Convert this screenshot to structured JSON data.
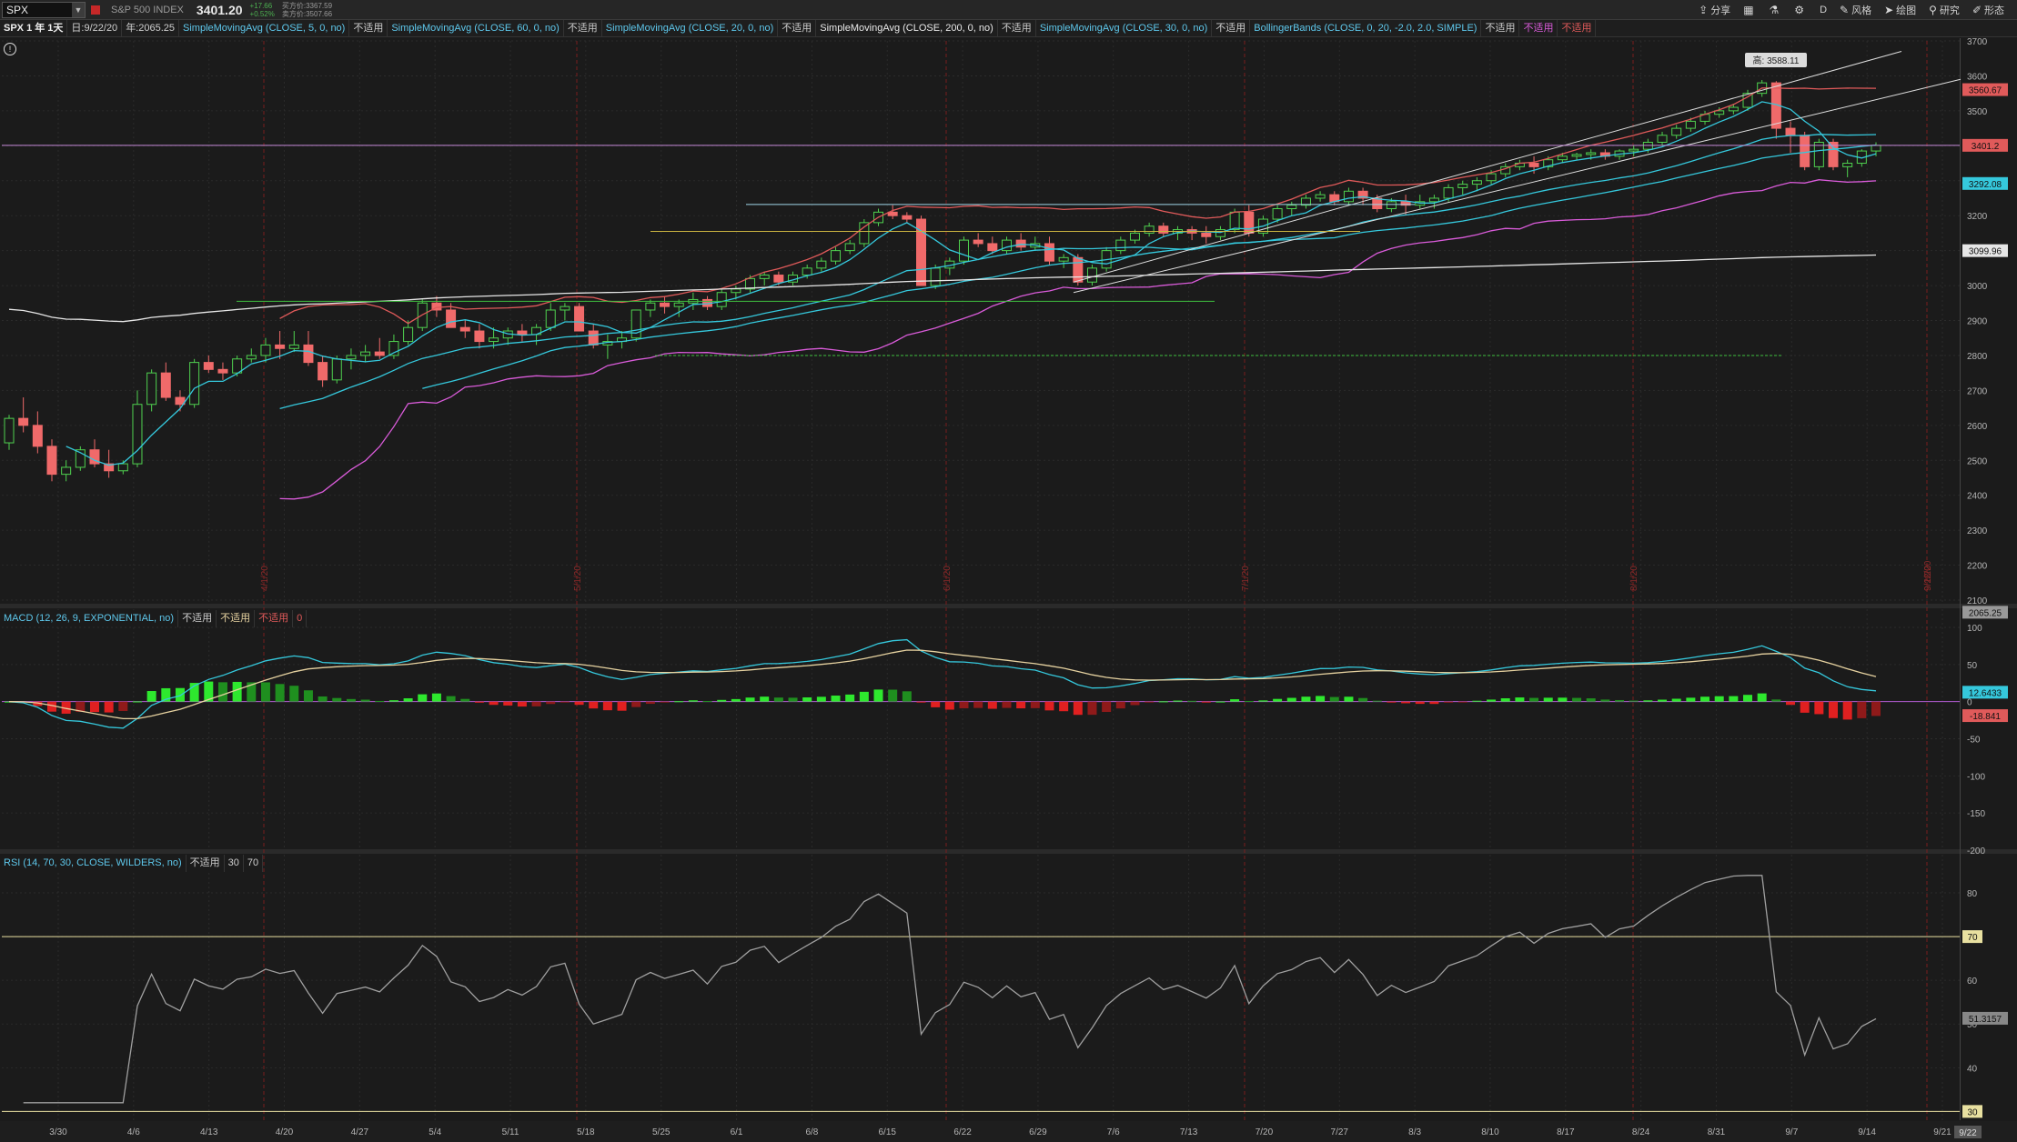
{
  "toolbar": {
    "symbol": "SPX",
    "index_name": "S&P 500 INDEX",
    "last_price": "3401.20",
    "change": "+17.66",
    "change_pct": "+0.52%",
    "bid_line": "买方价:3367.59",
    "ask_line": "卖方价:3507.66",
    "buttons": [
      {
        "label": "分享",
        "icon": "share-icon"
      },
      {
        "label": "",
        "icon": "calendar-icon"
      },
      {
        "label": "",
        "icon": "flask-icon"
      },
      {
        "label": "",
        "icon": "gear-icon"
      },
      {
        "label": "D",
        "icon": ""
      },
      {
        "label": "风格",
        "icon": "style-icon"
      },
      {
        "label": "绘图",
        "icon": "cursor-icon"
      },
      {
        "label": "研究",
        "icon": "study-icon"
      },
      {
        "label": "形态",
        "icon": "pattern-icon"
      }
    ]
  },
  "studybar": {
    "symbol_period": "SPX 1 年 1天",
    "date": "日:9/22/20",
    "year_value": "年:2065.25",
    "studies": [
      {
        "name": "SimpleMovingAvg (CLOSE, 5, 0, no)",
        "color": "#5ec8ec",
        "na": "不适用"
      },
      {
        "name": "SimpleMovingAvg (CLOSE, 60, 0, no)",
        "color": "#5ec8ec",
        "na": "不适用"
      },
      {
        "name": "SimpleMovingAvg (CLOSE, 20, 0, no)",
        "color": "#5ec8ec",
        "na": "不适用"
      },
      {
        "name": "SimpleMovingAvg (CLOSE, 200, 0, no)",
        "color": "#e8e8e8",
        "na": "不适用"
      },
      {
        "name": "SimpleMovingAvg (CLOSE, 30, 0, no)",
        "color": "#5ec8ec",
        "na": "不适用"
      },
      {
        "name": "BollingerBands (CLOSE, 0, 20, -2.0, 2.0, SIMPLE)",
        "color": "#5ec8ec",
        "na": "不适用"
      }
    ],
    "extra_na": [
      "不适用",
      "不适用"
    ]
  },
  "colors": {
    "up": "#4fd14f",
    "down": "#f06a6a",
    "grid": "#2b2b2b",
    "axis_text": "#b5b5b5",
    "ma_cyan": "#35c8dc",
    "ma_magenta": "#d95bd9",
    "ma_red": "#e05a5a",
    "ma_white": "#e6e6e6",
    "macd_line": "#35c8dc",
    "signal_line": "#e6d2a0",
    "rsi_line": "#a0a0a0",
    "rsi_ob": "#f06a50"
  },
  "price_pane": {
    "high_label": "高: 3588.11",
    "ticks": [
      "3700",
      "3600",
      "3500",
      "3400",
      "3300",
      "3200",
      "3100",
      "3000",
      "2900",
      "2800",
      "2700",
      "2600",
      "2500",
      "2400",
      "2300",
      "2200",
      "2100"
    ],
    "right_labels": [
      {
        "text": "3560.67",
        "value": 3560.67,
        "color": "#e05a5a"
      },
      {
        "text": "3401.2",
        "value": 3401.2,
        "color": "#e05a5a"
      },
      {
        "text": "3292.08",
        "value": 3292.08,
        "color": "#35c8dc"
      },
      {
        "text": "3099.96",
        "value": 3099.96,
        "color": "#e6e6e6"
      },
      {
        "text": "2065.25",
        "value": 2065.25,
        "color": "#999999"
      }
    ],
    "month_markers": [
      "4/1/20",
      "5/1/20",
      "6/1/20",
      "7/1/20",
      "8/1/20",
      "9/1/20",
      "9/22/20"
    ]
  },
  "macd_pane": {
    "label": "MACD (12, 26, 9, EXPONENTIAL, no)",
    "na": [
      "不适用",
      "不适用",
      "不适用"
    ],
    "zero": "0",
    "ticks": [
      "100",
      "50",
      "0",
      "-50",
      "-100",
      "-150",
      "-200"
    ],
    "right_labels": [
      {
        "text": "12.6433",
        "value": 12.6433,
        "color": "#35c8dc"
      },
      {
        "text": "-18.841",
        "value": -18.841,
        "color": "#e05a5a"
      }
    ]
  },
  "rsi_pane": {
    "label": "RSI (14, 70, 30, CLOSE, WILDERS, no)",
    "na": "不适用",
    "levels": [
      "30",
      "70"
    ],
    "ticks": [
      "80",
      "70",
      "60",
      "50",
      "40",
      "30"
    ],
    "right_label": {
      "text": "51.3157",
      "value": 51.3157
    }
  },
  "x_axis": {
    "dates": [
      "3/30",
      "4/6",
      "4/13",
      "4/20",
      "4/27",
      "5/4",
      "5/11",
      "5/18",
      "5/25",
      "6/1",
      "6/8",
      "6/15",
      "6/22",
      "6/29",
      "7/6",
      "7/13",
      "7/20",
      "7/27",
      "8/3",
      "8/10",
      "8/17",
      "8/24",
      "8/31",
      "9/7",
      "9/14",
      "9/21"
    ],
    "current": "9/22"
  },
  "chart_data": {
    "type": "candlestick",
    "candles": [
      [
        2550,
        2630,
        2530,
        2620
      ],
      [
        2620,
        2680,
        2580,
        2600
      ],
      [
        2600,
        2640,
        2520,
        2540
      ],
      [
        2540,
        2560,
        2440,
        2460
      ],
      [
        2460,
        2500,
        2440,
        2480
      ],
      [
        2480,
        2540,
        2470,
        2530
      ],
      [
        2530,
        2560,
        2480,
        2490
      ],
      [
        2490,
        2530,
        2450,
        2470
      ],
      [
        2470,
        2500,
        2460,
        2490
      ],
      [
        2490,
        2700,
        2480,
        2660
      ],
      [
        2660,
        2760,
        2640,
        2750
      ],
      [
        2750,
        2780,
        2670,
        2680
      ],
      [
        2680,
        2700,
        2640,
        2660
      ],
      [
        2660,
        2790,
        2650,
        2780
      ],
      [
        2780,
        2800,
        2750,
        2760
      ],
      [
        2760,
        2780,
        2730,
        2750
      ],
      [
        2750,
        2800,
        2740,
        2790
      ],
      [
        2790,
        2820,
        2780,
        2800
      ],
      [
        2800,
        2850,
        2780,
        2830
      ],
      [
        2830,
        2870,
        2790,
        2820
      ],
      [
        2820,
        2870,
        2810,
        2830
      ],
      [
        2830,
        2870,
        2770,
        2780
      ],
      [
        2780,
        2800,
        2710,
        2730
      ],
      [
        2730,
        2800,
        2720,
        2790
      ],
      [
        2790,
        2820,
        2760,
        2800
      ],
      [
        2800,
        2830,
        2780,
        2810
      ],
      [
        2810,
        2850,
        2790,
        2800
      ],
      [
        2800,
        2860,
        2790,
        2840
      ],
      [
        2840,
        2900,
        2830,
        2880
      ],
      [
        2880,
        2960,
        2870,
        2950
      ],
      [
        2950,
        2970,
        2910,
        2930
      ],
      [
        2930,
        2950,
        2890,
        2880
      ],
      [
        2880,
        2900,
        2850,
        2870
      ],
      [
        2870,
        2890,
        2820,
        2840
      ],
      [
        2840,
        2880,
        2820,
        2850
      ],
      [
        2850,
        2880,
        2830,
        2870
      ],
      [
        2870,
        2890,
        2840,
        2860
      ],
      [
        2860,
        2890,
        2830,
        2880
      ],
      [
        2880,
        2950,
        2870,
        2930
      ],
      [
        2930,
        2950,
        2900,
        2940
      ],
      [
        2940,
        2950,
        2880,
        2870
      ],
      [
        2870,
        2890,
        2820,
        2830
      ],
      [
        2830,
        2860,
        2790,
        2840
      ],
      [
        2840,
        2870,
        2820,
        2850
      ],
      [
        2850,
        2930,
        2840,
        2930
      ],
      [
        2930,
        2960,
        2910,
        2950
      ],
      [
        2950,
        2970,
        2920,
        2940
      ],
      [
        2940,
        2960,
        2910,
        2950
      ],
      [
        2950,
        2980,
        2930,
        2960
      ],
      [
        2960,
        2970,
        2930,
        2940
      ],
      [
        2940,
        2990,
        2930,
        2980
      ],
      [
        2980,
        3000,
        2960,
        2990
      ],
      [
        2990,
        3030,
        2980,
        3020
      ],
      [
        3020,
        3040,
        3000,
        3030
      ],
      [
        3030,
        3040,
        3000,
        3010
      ],
      [
        3010,
        3040,
        3000,
        3030
      ],
      [
        3030,
        3060,
        3020,
        3050
      ],
      [
        3050,
        3080,
        3040,
        3070
      ],
      [
        3070,
        3110,
        3060,
        3100
      ],
      [
        3100,
        3130,
        3090,
        3120
      ],
      [
        3120,
        3190,
        3110,
        3180
      ],
      [
        3180,
        3220,
        3170,
        3210
      ],
      [
        3210,
        3230,
        3190,
        3200
      ],
      [
        3200,
        3210,
        3180,
        3190
      ],
      [
        3190,
        3200,
        3120,
        3000
      ],
      [
        3000,
        3060,
        2990,
        3050
      ],
      [
        3050,
        3080,
        3030,
        3070
      ],
      [
        3070,
        3140,
        3060,
        3130
      ],
      [
        3130,
        3150,
        3110,
        3120
      ],
      [
        3120,
        3140,
        3090,
        3100
      ],
      [
        3100,
        3140,
        3090,
        3130
      ],
      [
        3130,
        3150,
        3100,
        3110
      ],
      [
        3110,
        3140,
        3100,
        3120
      ],
      [
        3120,
        3140,
        3060,
        3070
      ],
      [
        3070,
        3090,
        3050,
        3080
      ],
      [
        3080,
        3090,
        3000,
        3010
      ],
      [
        3010,
        3060,
        3000,
        3050
      ],
      [
        3050,
        3110,
        3040,
        3100
      ],
      [
        3100,
        3140,
        3090,
        3130
      ],
      [
        3130,
        3160,
        3120,
        3150
      ],
      [
        3150,
        3180,
        3140,
        3170
      ],
      [
        3170,
        3180,
        3140,
        3150
      ],
      [
        3150,
        3170,
        3130,
        3160
      ],
      [
        3160,
        3170,
        3130,
        3150
      ],
      [
        3150,
        3170,
        3120,
        3140
      ],
      [
        3140,
        3170,
        3130,
        3160
      ],
      [
        3160,
        3220,
        3150,
        3210
      ],
      [
        3210,
        3230,
        3140,
        3150
      ],
      [
        3150,
        3200,
        3140,
        3190
      ],
      [
        3190,
        3230,
        3180,
        3220
      ],
      [
        3220,
        3240,
        3200,
        3230
      ],
      [
        3230,
        3260,
        3220,
        3250
      ],
      [
        3250,
        3270,
        3240,
        3260
      ],
      [
        3260,
        3270,
        3230,
        3240
      ],
      [
        3240,
        3280,
        3230,
        3270
      ],
      [
        3270,
        3280,
        3230,
        3250
      ],
      [
        3250,
        3260,
        3210,
        3220
      ],
      [
        3220,
        3250,
        3210,
        3240
      ],
      [
        3240,
        3260,
        3200,
        3230
      ],
      [
        3230,
        3260,
        3220,
        3240
      ],
      [
        3240,
        3260,
        3220,
        3250
      ],
      [
        3250,
        3290,
        3240,
        3280
      ],
      [
        3280,
        3300,
        3260,
        3290
      ],
      [
        3290,
        3310,
        3270,
        3300
      ],
      [
        3300,
        3330,
        3290,
        3320
      ],
      [
        3320,
        3350,
        3310,
        3340
      ],
      [
        3340,
        3360,
        3330,
        3350
      ],
      [
        3350,
        3370,
        3320,
        3340
      ],
      [
        3340,
        3370,
        3330,
        3360
      ],
      [
        3360,
        3380,
        3350,
        3370
      ],
      [
        3370,
        3380,
        3360,
        3375
      ],
      [
        3375,
        3390,
        3360,
        3380
      ],
      [
        3380,
        3390,
        3360,
        3370
      ],
      [
        3370,
        3390,
        3360,
        3385
      ],
      [
        3385,
        3400,
        3370,
        3390
      ],
      [
        3390,
        3420,
        3380,
        3410
      ],
      [
        3410,
        3440,
        3400,
        3430
      ],
      [
        3430,
        3460,
        3420,
        3450
      ],
      [
        3450,
        3480,
        3440,
        3470
      ],
      [
        3470,
        3500,
        3460,
        3490
      ],
      [
        3490,
        3510,
        3480,
        3500
      ],
      [
        3500,
        3520,
        3490,
        3510
      ],
      [
        3510,
        3560,
        3500,
        3550
      ],
      [
        3550,
        3588.11,
        3540,
        3580
      ],
      [
        3580,
        3585,
        3420,
        3450
      ],
      [
        3450,
        3470,
        3380,
        3430
      ],
      [
        3430,
        3440,
        3330,
        3340
      ],
      [
        3340,
        3420,
        3330,
        3410
      ],
      [
        3410,
        3420,
        3330,
        3340
      ],
      [
        3340,
        3360,
        3310,
        3350
      ],
      [
        3350,
        3390,
        3340,
        3385
      ],
      [
        3385,
        3410,
        3370,
        3401.2
      ]
    ]
  }
}
